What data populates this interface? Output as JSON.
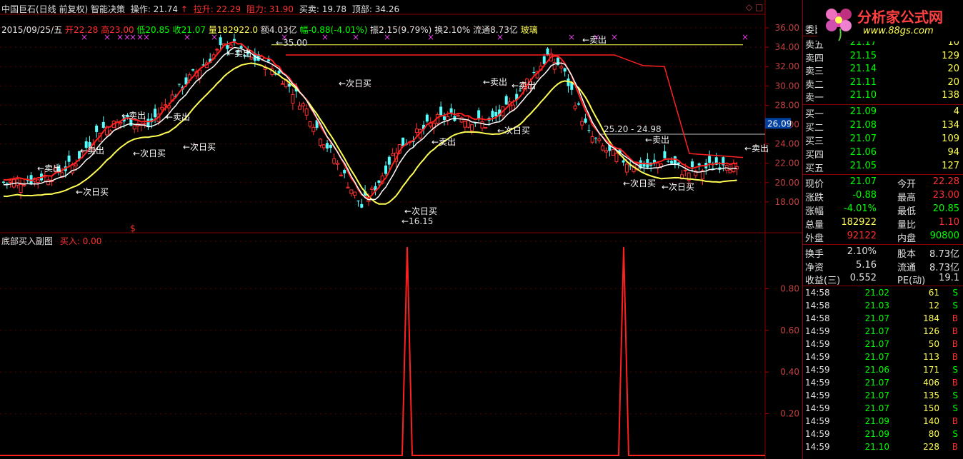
{
  "header": {
    "name": "中国巨石(日线 前复权) 智能决策",
    "op_label": "操作: 21.74",
    "up_arrow": "↑",
    "pull_label": "拉升: 22.29",
    "resist_label": "阻力: 31.90",
    "trade_label": "买卖: 19.78",
    "top_label": "顶部: 34.26",
    "win_icons": "◇ □"
  },
  "ohlc": {
    "date": "2015/09/25/五",
    "open": "开22.28",
    "high": "高23.00",
    "low": "低20.85",
    "close": "收21.07",
    "volume": "量182922.0",
    "amount": "额4.03亿",
    "change": "幅-0.88(-4.01%)",
    "amplitude": "振2.15(9.79%)",
    "turnover": "换2.10%",
    "float": "流通8.73亿",
    "sector": "玻璃"
  },
  "chart_data": {
    "type": "candlestick",
    "y_axis_ticks": [
      "36.00",
      "34.00",
      "32.00",
      "30.00",
      "28.00",
      "26.00",
      "24.00",
      "22.00",
      "20.00",
      "18.00"
    ],
    "current_price_tag": "26.09",
    "range_label": "25.20 - 24.98",
    "peak_label": "35.00",
    "low_label": "16.15",
    "buy_label": "←次日买",
    "sell_label": "←卖出",
    "sub_title": "底部买入副图",
    "sub_series_label": "买入: 0.00",
    "sub_y_ticks": [
      "0.80",
      "0.60",
      "0.40",
      "0.20"
    ],
    "sub_spikes_value": 1.0,
    "colors": {
      "up": "#ff3030",
      "down": "#54ffff",
      "ma_yellow": "#ffff54",
      "ma_red": "#ff2020",
      "ma_white": "#ffffff",
      "spike": "#ff2020"
    }
  },
  "panel": {
    "logo_text": "分析家公式网",
    "logo_url": "www.88gs.com",
    "committee_label": "委比",
    "sell_orders": [
      {
        "label": "卖五",
        "price": "21.17",
        "vol": "10"
      },
      {
        "label": "卖四",
        "price": "21.15",
        "vol": "129"
      },
      {
        "label": "卖三",
        "price": "21.14",
        "vol": "20"
      },
      {
        "label": "卖二",
        "price": "21.11",
        "vol": "20"
      },
      {
        "label": "卖一",
        "price": "21.10",
        "vol": "138"
      }
    ],
    "buy_orders": [
      {
        "label": "买一",
        "price": "21.09",
        "vol": "4"
      },
      {
        "label": "买二",
        "price": "21.08",
        "vol": "134"
      },
      {
        "label": "买三",
        "price": "21.07",
        "vol": "109"
      },
      {
        "label": "买四",
        "price": "21.06",
        "vol": "94"
      },
      {
        "label": "买五",
        "price": "21.05",
        "vol": "127"
      }
    ],
    "quote": [
      {
        "l1": "现价",
        "v1": "21.07",
        "l2": "今开",
        "v2": "22.28",
        "c1": "#00ff00",
        "c2": "#ff3030"
      },
      {
        "l1": "涨跌",
        "v1": "-0.88",
        "l2": "最高",
        "v2": "23.00",
        "c1": "#00ff00",
        "c2": "#ff3030"
      },
      {
        "l1": "涨幅",
        "v1": "-4.01%",
        "l2": "最低",
        "v2": "20.85",
        "c1": "#00ff00",
        "c2": "#00ff00"
      },
      {
        "l1": "总量",
        "v1": "182922",
        "l2": "量比",
        "v2": "1.10",
        "c1": "#ffff54",
        "c2": "#ff3030"
      },
      {
        "l1": "外盘",
        "v1": "92122",
        "l2": "内盘",
        "v2": "90800",
        "c1": "#ff3030",
        "c2": "#00ff00"
      }
    ],
    "fundamentals": [
      {
        "l1": "换手",
        "v1": "2.10%",
        "l2": "股本",
        "v2": "8.73亿"
      },
      {
        "l1": "净资",
        "v1": "5.16",
        "l2": "流通",
        "v2": "8.73亿"
      },
      {
        "l1": "收益(三)",
        "v1": "0.552",
        "l2": "PE(动)",
        "v2": "19.1"
      }
    ],
    "ticks": [
      {
        "t": "14:58",
        "p": "21.02",
        "v": "61",
        "s": "S"
      },
      {
        "t": "14:58",
        "p": "21.03",
        "v": "12",
        "s": "S"
      },
      {
        "t": "14:58",
        "p": "21.07",
        "v": "184",
        "s": "B"
      },
      {
        "t": "14:59",
        "p": "21.07",
        "v": "126",
        "s": "B"
      },
      {
        "t": "14:59",
        "p": "21.07",
        "v": "50",
        "s": "B"
      },
      {
        "t": "14:59",
        "p": "21.07",
        "v": "113",
        "s": "B"
      },
      {
        "t": "14:59",
        "p": "21.06",
        "v": "171",
        "s": "S"
      },
      {
        "t": "14:59",
        "p": "21.07",
        "v": "406",
        "s": "B"
      },
      {
        "t": "14:59",
        "p": "21.07",
        "v": "135",
        "s": "S"
      },
      {
        "t": "14:59",
        "p": "21.07",
        "v": "150",
        "s": "S"
      },
      {
        "t": "14:59",
        "p": "21.09",
        "v": "140",
        "s": "B"
      },
      {
        "t": "14:59",
        "p": "21.09",
        "v": "80",
        "s": "S"
      },
      {
        "t": "14:59",
        "p": "21.10",
        "v": "228",
        "s": "B"
      }
    ]
  }
}
